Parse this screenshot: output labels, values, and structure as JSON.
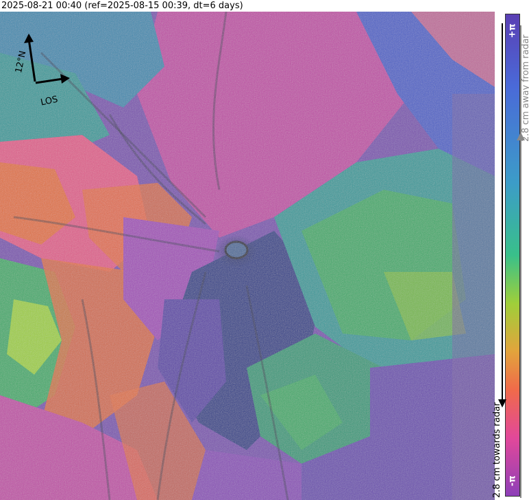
{
  "header": {
    "title": "2025-08-21 00:40 (ref=2025-08-15 00:39, dt=6 days)"
  },
  "map_overlay": {
    "north_label": "12°N",
    "los_label": "LOS"
  },
  "colorbar": {
    "top_label": "+π",
    "bottom_label": "-π",
    "away_label": "2.8 cm away from radar",
    "toward_label": "2.8 cm towards radar",
    "colors": [
      "#5a3fb4",
      "#4a6ad8",
      "#3c9cc8",
      "#39c08a",
      "#9fcf3a",
      "#e2a43c",
      "#f06a4a",
      "#e2489a",
      "#8e3fb8"
    ]
  },
  "colors": {
    "magenta": "#c84aa8",
    "purple": "#7a4fb0",
    "blue": "#4a5fc8",
    "teal": "#2e9a9a",
    "green": "#3cab6a",
    "orange": "#e2703c",
    "pink": "#e05a8a",
    "dark_blue": "#2a3a8a"
  }
}
